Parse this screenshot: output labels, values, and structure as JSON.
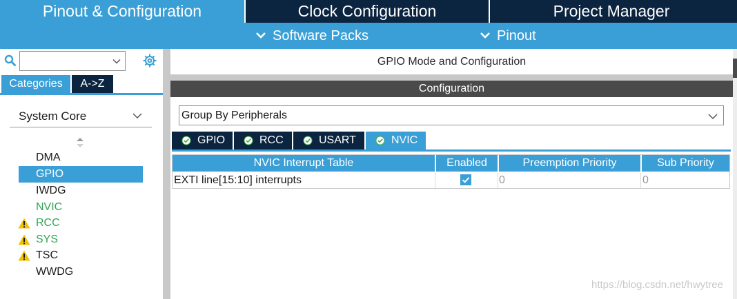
{
  "top_tabs": {
    "pinout_config": "Pinout & Configuration",
    "clock_config": "Clock Configuration",
    "project_manager": "Project Manager"
  },
  "sub_menu": {
    "software_packs": "Software Packs",
    "pinout": "Pinout"
  },
  "left": {
    "search": {
      "value": ""
    },
    "tabs": {
      "categories": "Categories",
      "az": "A->Z"
    },
    "category": "System Core",
    "peripherals": [
      {
        "label": "DMA"
      },
      {
        "label": "GPIO"
      },
      {
        "label": "IWDG"
      },
      {
        "label": "NVIC"
      },
      {
        "label": "RCC"
      },
      {
        "label": "SYS"
      },
      {
        "label": "TSC"
      },
      {
        "label": "WWDG"
      }
    ]
  },
  "right": {
    "title": "GPIO Mode and Configuration",
    "config_header": "Configuration",
    "group_by": "Group By Peripherals",
    "tabs": [
      "GPIO",
      "RCC",
      "USART",
      "NVIC"
    ],
    "table": {
      "headers": [
        "NVIC Interrupt Table",
        "Enabled",
        "Preemption Priority",
        "Sub Priority"
      ],
      "rows": [
        {
          "name": "EXTI line[15:10] interrupts",
          "enabled": true,
          "preemption": "0",
          "sub": "0"
        }
      ]
    }
  },
  "watermark": "https://blog.csdn.net/hwytree",
  "colors": {
    "accent_blue": "#3a9fd6",
    "dark_navy": "#0b2440",
    "status_green": "#31a354",
    "warning_yellow": "#f2c200"
  }
}
